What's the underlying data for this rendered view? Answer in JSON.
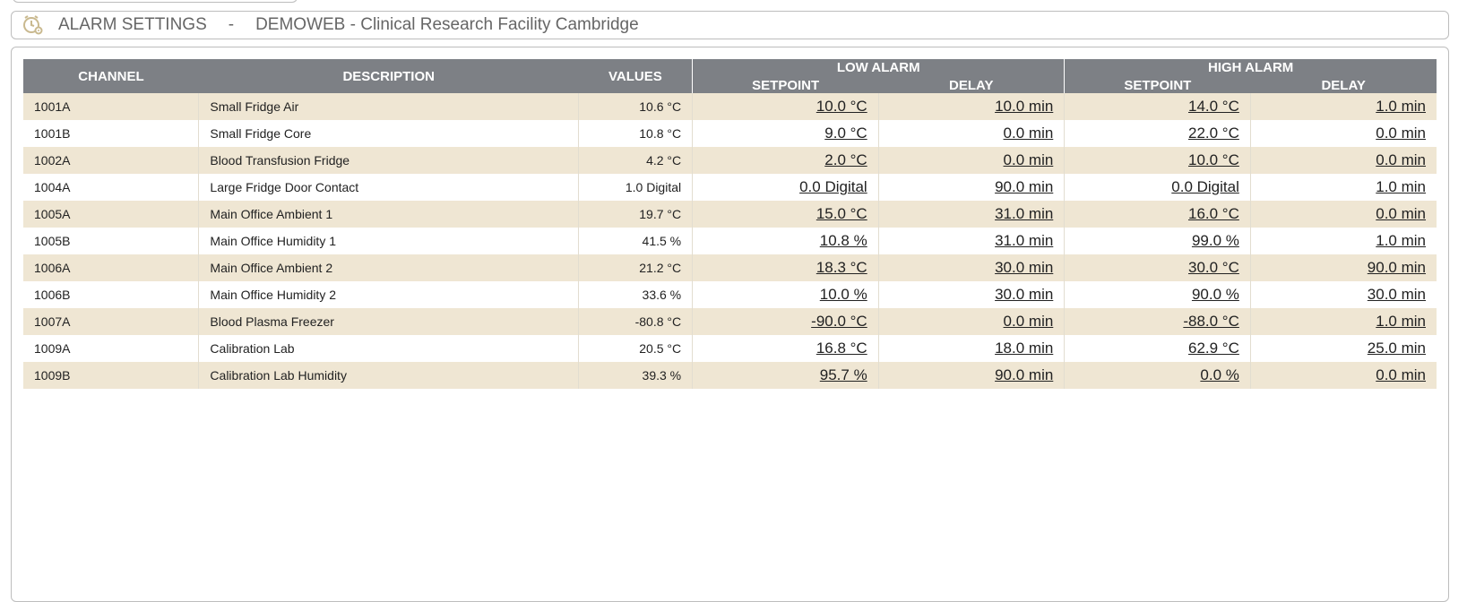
{
  "header": {
    "title": "ALARM SETTINGS",
    "separator": "-",
    "site": "DEMOWEB - Clinical Research Facility Cambridge",
    "icon": "alarm-clock-gear-icon"
  },
  "colors": {
    "header_bg": "#7d8085",
    "row_odd": "#efe6d3",
    "row_even": "#ffffff",
    "icon_accent": "#c9b98f"
  },
  "columns": {
    "channel": "CHANNEL",
    "description": "DESCRIPTION",
    "values": "VALUES",
    "low_alarm": "LOW ALARM",
    "high_alarm": "HIGH ALARM",
    "setpoint": "SETPOINT",
    "delay": "DELAY"
  },
  "rows": [
    {
      "channel": "1001A",
      "description": "Small Fridge Air",
      "value": "10.6 °C",
      "low_setpoint": "10.0 °C",
      "low_delay": "10.0 min",
      "high_setpoint": "14.0 °C",
      "high_delay": "1.0 min"
    },
    {
      "channel": "1001B",
      "description": "Small Fridge Core",
      "value": "10.8 °C",
      "low_setpoint": "9.0 °C",
      "low_delay": "0.0 min",
      "high_setpoint": "22.0 °C",
      "high_delay": "0.0 min"
    },
    {
      "channel": "1002A",
      "description": "Blood Transfusion Fridge",
      "value": "4.2 °C",
      "low_setpoint": "2.0 °C",
      "low_delay": "0.0 min",
      "high_setpoint": "10.0 °C",
      "high_delay": "0.0 min"
    },
    {
      "channel": "1004A",
      "description": "Large Fridge Door Contact",
      "value": "1.0 Digital",
      "low_setpoint": "0.0 Digital",
      "low_delay": "90.0 min",
      "high_setpoint": "0.0 Digital",
      "high_delay": "1.0 min"
    },
    {
      "channel": "1005A",
      "description": "Main Office Ambient 1",
      "value": "19.7 °C",
      "low_setpoint": "15.0 °C",
      "low_delay": "31.0 min",
      "high_setpoint": "16.0 °C",
      "high_delay": "0.0 min"
    },
    {
      "channel": "1005B",
      "description": "Main Office Humidity 1",
      "value": "41.5 %",
      "low_setpoint": "10.8 %",
      "low_delay": "31.0 min",
      "high_setpoint": "99.0 %",
      "high_delay": "1.0 min"
    },
    {
      "channel": "1006A",
      "description": "Main Office Ambient 2",
      "value": "21.2 °C",
      "low_setpoint": "18.3 °C",
      "low_delay": "30.0 min",
      "high_setpoint": "30.0 °C",
      "high_delay": "90.0 min"
    },
    {
      "channel": "1006B",
      "description": "Main Office Humidity 2",
      "value": "33.6 %",
      "low_setpoint": "10.0 %",
      "low_delay": "30.0 min",
      "high_setpoint": "90.0 %",
      "high_delay": "30.0 min"
    },
    {
      "channel": "1007A",
      "description": "Blood Plasma Freezer",
      "value": "-80.8 °C",
      "low_setpoint": "-90.0 °C",
      "low_delay": "0.0 min",
      "high_setpoint": "-88.0 °C",
      "high_delay": "1.0 min"
    },
    {
      "channel": "1009A",
      "description": "Calibration Lab",
      "value": "20.5 °C",
      "low_setpoint": "16.8 °C",
      "low_delay": "18.0 min",
      "high_setpoint": "62.9 °C",
      "high_delay": "25.0 min"
    },
    {
      "channel": "1009B",
      "description": "Calibration Lab Humidity",
      "value": "39.3 %",
      "low_setpoint": "95.7 %",
      "low_delay": "90.0 min",
      "high_setpoint": "0.0 %",
      "high_delay": "0.0 min"
    }
  ]
}
